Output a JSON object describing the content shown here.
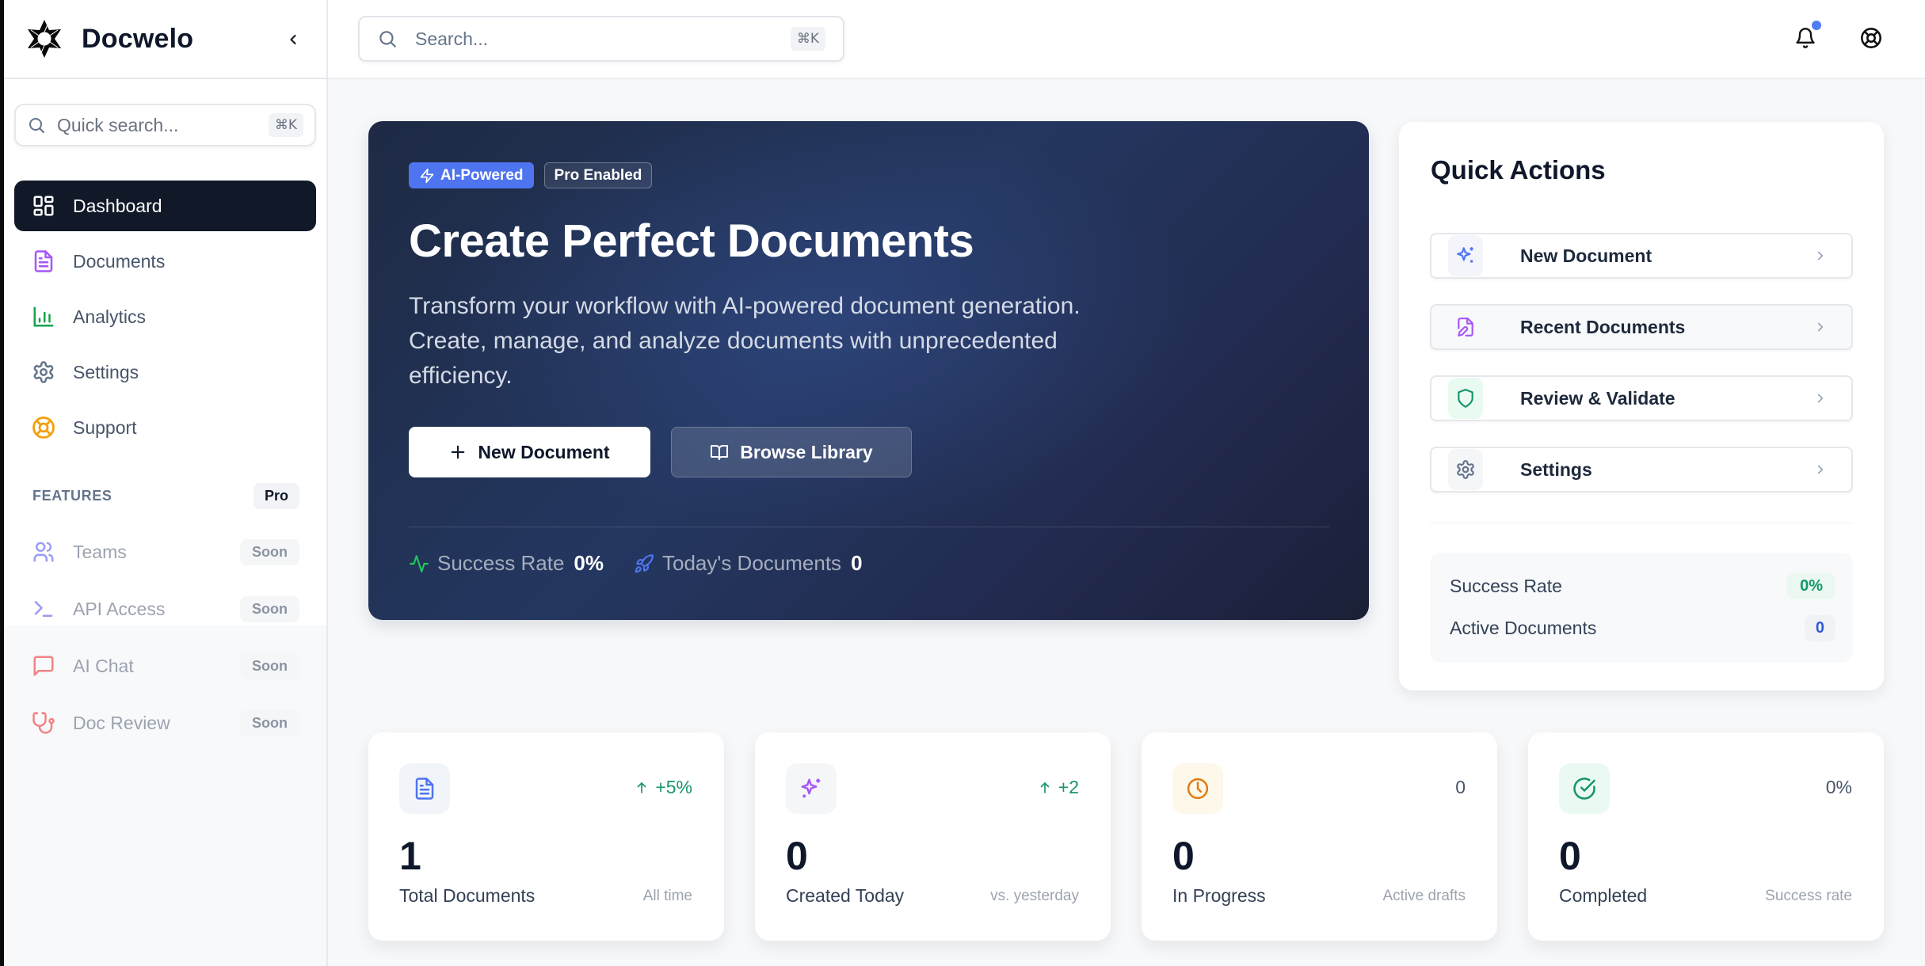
{
  "app": {
    "name": "Docwelo"
  },
  "sidebar": {
    "quick_search_placeholder": "Quick search...",
    "shortcut": "⌘K",
    "nav": [
      {
        "label": "Dashboard",
        "icon": "dashboard-icon",
        "active": true,
        "color": "#ffffff"
      },
      {
        "label": "Documents",
        "icon": "document-icon",
        "color": "#a855f7"
      },
      {
        "label": "Analytics",
        "icon": "bar-chart-icon",
        "color": "#16a34a"
      },
      {
        "label": "Settings",
        "icon": "gear-icon",
        "color": "#64748b"
      },
      {
        "label": "Support",
        "icon": "life-buoy-icon",
        "color": "#f59e0b"
      }
    ],
    "features": {
      "title": "FEATURES",
      "badge": "Pro",
      "items": [
        {
          "label": "Teams",
          "badge": "Soon",
          "icon": "users-icon",
          "color": "#6366f1"
        },
        {
          "label": "API Access",
          "badge": "Soon",
          "icon": "terminal-icon",
          "color": "#6366f1"
        },
        {
          "label": "AI Chat",
          "badge": "Soon",
          "icon": "chat-icon",
          "color": "#ef4444"
        },
        {
          "label": "Doc Review",
          "badge": "Soon",
          "icon": "stethoscope-icon",
          "color": "#ef4444"
        }
      ]
    }
  },
  "topbar": {
    "search_placeholder": "Search...",
    "shortcut": "⌘K",
    "notification_dot_color": "#4f7df3"
  },
  "hero": {
    "badges": {
      "ai": "AI-Powered",
      "pro": "Pro Enabled"
    },
    "title": "Create Perfect Documents",
    "description": "Transform your workflow with AI-powered document generation. Create, manage, and analyze documents with unprecedented efficiency.",
    "buttons": {
      "primary": "New Document",
      "secondary": "Browse Library"
    },
    "stats": [
      {
        "label": "Success Rate",
        "value": "0%",
        "icon": "activity-icon",
        "color": "#22c55e"
      },
      {
        "label": "Today's Documents",
        "value": "0",
        "icon": "rocket-icon",
        "color": "#4f74ef"
      }
    ]
  },
  "quick_actions": {
    "title": "Quick Actions",
    "items": [
      {
        "label": "New Document",
        "icon": "sparkles-icon"
      },
      {
        "label": "Recent Documents",
        "icon": "file-edit-icon"
      },
      {
        "label": "Review & Validate",
        "icon": "shield-icon"
      },
      {
        "label": "Settings",
        "icon": "gear-icon"
      }
    ],
    "stats": [
      {
        "label": "Success Rate",
        "value": "0%"
      },
      {
        "label": "Active Documents",
        "value": "0"
      }
    ]
  },
  "stat_cards": [
    {
      "value": "1",
      "label": "Total Documents",
      "sub": "All time",
      "trend": "+5%",
      "trend_dir": "up",
      "icon": "file-text-icon"
    },
    {
      "value": "0",
      "label": "Created Today",
      "sub": "vs. yesterday",
      "trend": "+2",
      "trend_dir": "up",
      "icon": "sparkles-icon"
    },
    {
      "value": "0",
      "label": "In Progress",
      "sub": "Active drafts",
      "trend": "0",
      "trend_dir": "neutral",
      "icon": "clock-icon"
    },
    {
      "value": "0",
      "label": "Completed",
      "sub": "Success rate",
      "trend": "0%",
      "trend_dir": "neutral",
      "icon": "check-circle-icon"
    }
  ]
}
